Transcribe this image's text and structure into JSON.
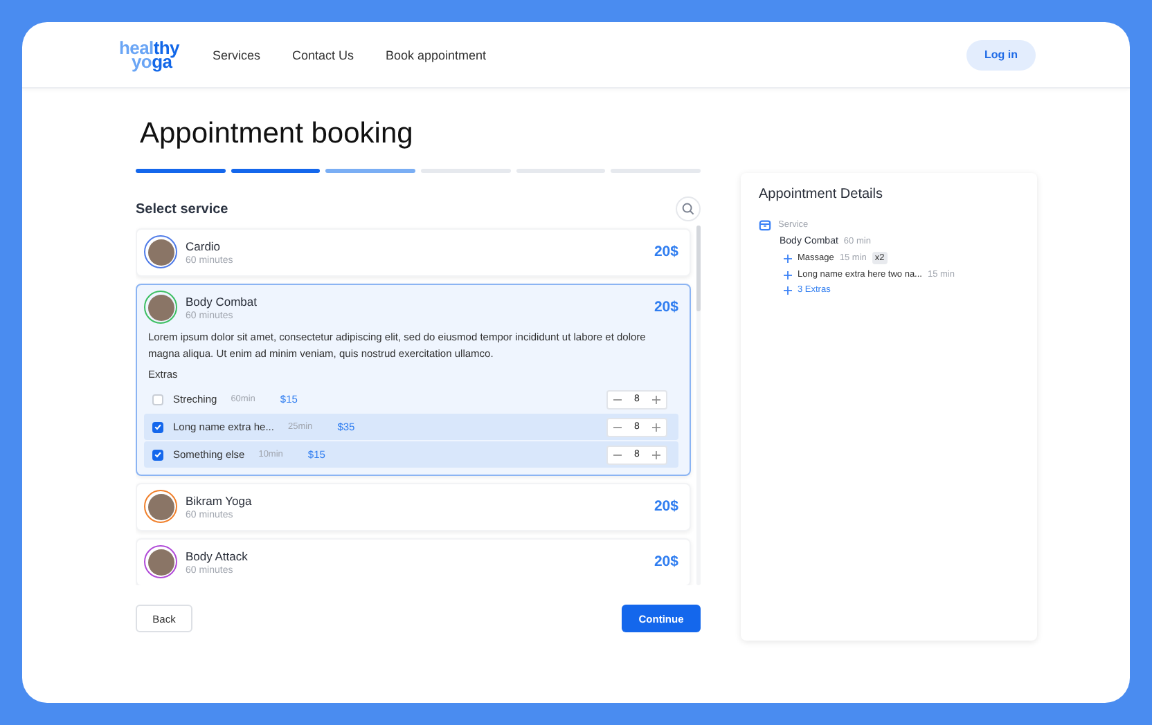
{
  "header": {
    "logo": [
      [
        {
          "text": "heal",
          "strong": false
        },
        {
          "text": "thy",
          "strong": true
        }
      ],
      [
        {
          "text": "yo",
          "strong": false
        },
        {
          "text": "ga",
          "strong": true
        }
      ]
    ],
    "nav": [
      "Services",
      "Contact Us",
      "Book appointment"
    ],
    "login": "Log in"
  },
  "title": "Appointment booking",
  "steps": [
    {
      "completed": true,
      "active": false
    },
    {
      "completed": true,
      "active": false
    },
    {
      "completed": false,
      "active": true
    },
    {
      "completed": false,
      "active": false
    },
    {
      "completed": false,
      "active": false
    },
    {
      "completed": false,
      "active": false
    }
  ],
  "section_title": "Select service",
  "services": [
    {
      "name": "Cardio",
      "duration": "60 minutes",
      "price": "20$",
      "color": "#4f7be8",
      "selected": false
    },
    {
      "name": "Body Combat",
      "duration": "60 minutes",
      "price": "20$",
      "color": "#3cbf62",
      "selected": true,
      "description": "Lorem ipsum dolor sit amet, consectetur adipiscing elit, sed do eiusmod tempor incididunt ut labore et dolore magna aliqua. Ut enim ad minim veniam, quis nostrud exercitation ullamco.",
      "extras_label": "Extras",
      "extras": [
        {
          "name": "Streching",
          "duration": "60min",
          "price": "$15",
          "quantity": "8",
          "checked": false
        },
        {
          "name": "Long name extra he...",
          "duration": "25min",
          "price": "$35",
          "quantity": "8",
          "checked": true
        },
        {
          "name": "Something else",
          "duration": "10min",
          "price": "$15",
          "quantity": "8",
          "checked": true
        }
      ]
    },
    {
      "name": "Bikram Yoga",
      "duration": "60 minutes",
      "price": "20$",
      "color": "#f07f2a",
      "selected": false
    },
    {
      "name": "Body Attack",
      "duration": "60 minutes",
      "price": "20$",
      "color": "#b04ad8",
      "selected": false
    }
  ],
  "back": "Back",
  "continue": "Continue",
  "details": {
    "title": "Appointment Details",
    "section": "Service",
    "service": "Body Combat",
    "service_duration": "60 min",
    "items": [
      {
        "kind": "extra",
        "name": "Massage",
        "duration": "15 min",
        "badge": "x2"
      },
      {
        "kind": "extra",
        "name": "Long name extra here two na...",
        "duration": "15 min"
      },
      {
        "kind": "more",
        "name": "3 Extras"
      }
    ]
  }
}
